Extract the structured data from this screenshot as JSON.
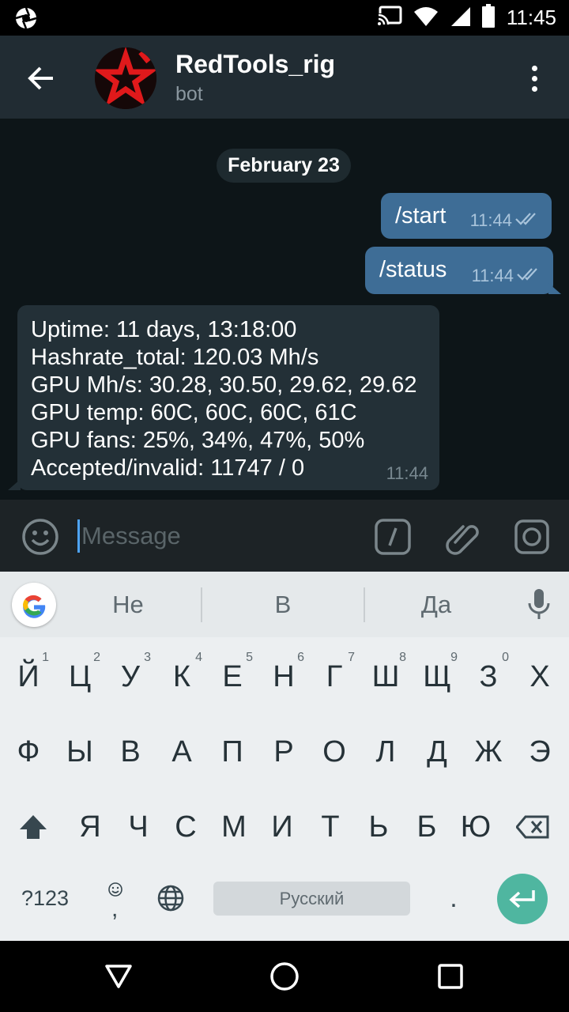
{
  "status_bar": {
    "time": "11:45",
    "icons": [
      "camera-aperture-icon",
      "cast-icon",
      "wifi-icon",
      "signal-icon",
      "battery-icon"
    ]
  },
  "header": {
    "title": "RedTools_rig",
    "subtitle": "bot",
    "avatar_color": "#e0191b"
  },
  "chat": {
    "date": "February 23",
    "outgoing": [
      {
        "text": "/start",
        "time": "11:44"
      },
      {
        "text": "/status",
        "time": "11:44"
      }
    ],
    "incoming": {
      "lines": [
        "Uptime: 11 days, 13:18:00",
        "Hashrate_total: 120.03 Mh/s",
        "GPU Mh/s: 30.28, 30.50, 29.62, 29.62",
        "GPU temp: 60C, 60C, 60C, 61C",
        "GPU fans: 25%, 34%, 47%, 50%",
        "Accepted/invalid: 11747 / 0"
      ],
      "time": "11:44"
    }
  },
  "input": {
    "placeholder": "Message",
    "value": ""
  },
  "keyboard": {
    "suggestions": [
      "Не",
      "В",
      "Да"
    ],
    "row1": [
      {
        "k": "Й",
        "h": "1"
      },
      {
        "k": "Ц",
        "h": "2"
      },
      {
        "k": "У",
        "h": "3"
      },
      {
        "k": "К",
        "h": "4"
      },
      {
        "k": "Е",
        "h": "5"
      },
      {
        "k": "Н",
        "h": "6"
      },
      {
        "k": "Г",
        "h": "7"
      },
      {
        "k": "Ш",
        "h": "8"
      },
      {
        "k": "Щ",
        "h": "9"
      },
      {
        "k": "З",
        "h": "0"
      },
      {
        "k": "Х",
        "h": ""
      }
    ],
    "row2": [
      "Ф",
      "Ы",
      "В",
      "А",
      "П",
      "Р",
      "О",
      "Л",
      "Д",
      "Ж",
      "Э"
    ],
    "row3": [
      "Я",
      "Ч",
      "С",
      "М",
      "И",
      "Т",
      "Ь",
      "Б",
      "Ю"
    ],
    "symbols_label": "?123",
    "emoji_comma": ",",
    "space_label": "Русский",
    "period": ".",
    "accent_color": "#4fb6a0"
  }
}
